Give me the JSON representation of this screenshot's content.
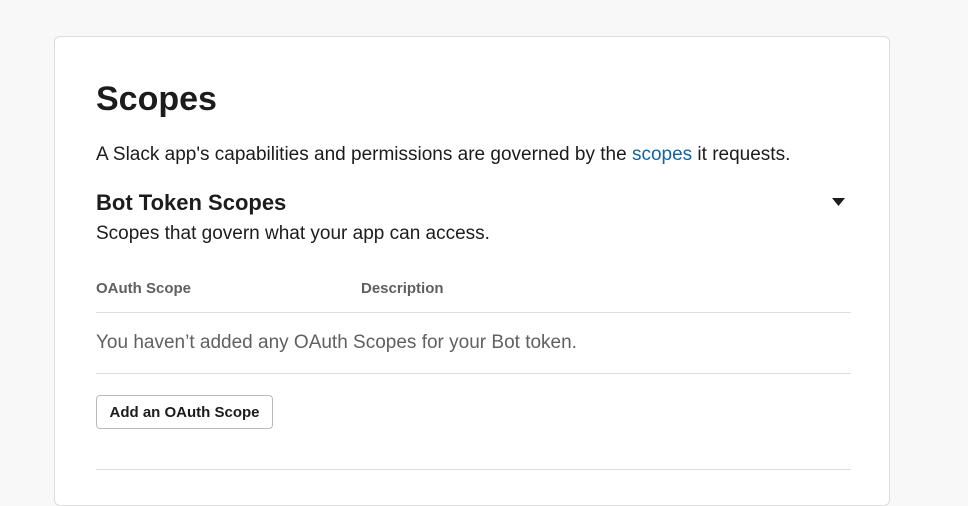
{
  "scopes_section": {
    "title": "Scopes",
    "intro_before_link": "A Slack app's capabilities and permissions are governed by the ",
    "intro_link": "scopes",
    "intro_after_link": " it requests.",
    "link_color": "#1264a3"
  },
  "bot_token": {
    "title": "Bot Token Scopes",
    "description": "Scopes that govern what your app can access.",
    "toggle_icon": "caret-down-icon",
    "table": {
      "columns": [
        "OAuth Scope",
        "Description"
      ],
      "empty_message": "You haven’t added any OAuth Scopes for your Bot token."
    },
    "add_button_label": "Add an OAuth Scope"
  }
}
